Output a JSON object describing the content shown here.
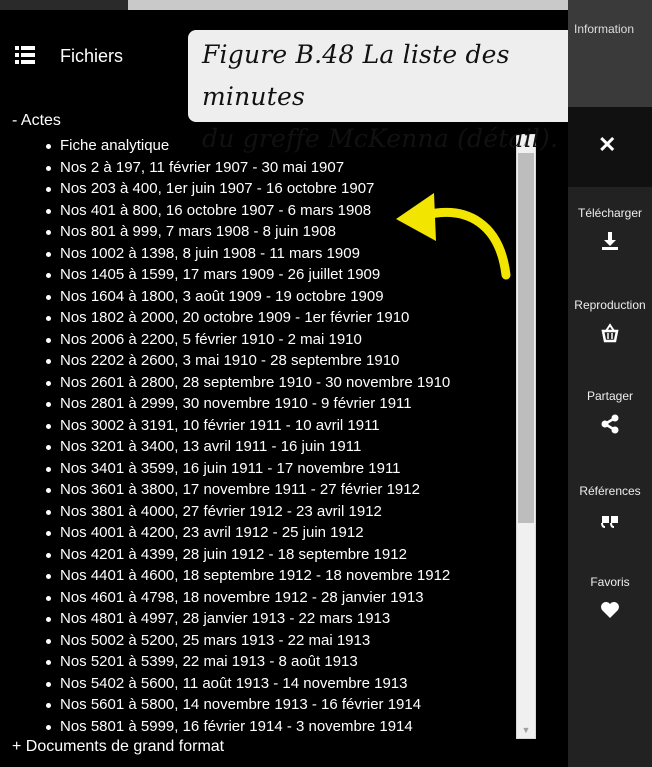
{
  "header": {
    "title": "Fichiers",
    "menu_icon": "list-icon"
  },
  "caption": {
    "line1": "Figure B.48 La liste des minutes",
    "line2": "du greffe McKenna (détail)."
  },
  "tree": {
    "root_label": "- Actes",
    "items": [
      "Fiche analytique",
      "Nos 2 à 197, 11 février 1907 - 30 mai 1907",
      "Nos 203 à 400, 1er juin 1907 - 16 octobre 1907",
      "Nos 401 à 800, 16 octobre 1907 - 6 mars 1908",
      "Nos 801 à 999, 7 mars 1908 - 8 juin 1908",
      "Nos 1002 à 1398, 8 juin 1908 - 11 mars 1909",
      "Nos 1405 à 1599, 17 mars 1909 - 26 juillet 1909",
      "Nos 1604 à 1800, 3 août 1909 - 19 octobre 1909",
      "Nos 1802 à 2000, 20 octobre 1909 - 1er février 1910",
      "Nos 2006 à 2200, 5 février 1910 - 2 mai 1910",
      "Nos 2202 à 2600, 3 mai 1910 - 28 septembre 1910",
      "Nos 2601 à 2800, 28 septembre 1910 - 30 novembre 1910",
      "Nos 2801 à 2999, 30 novembre 1910 - 9 février 1911",
      "Nos 3002 à 3191, 10 février 1911 - 10 avril 1911",
      "Nos 3201 à 3400, 13 avril 1911 - 16 juin 1911",
      "Nos 3401 à 3599, 16 juin 1911 - 17 novembre 1911",
      "Nos 3601 à 3800, 17 novembre 1911 - 27 février 1912",
      "Nos 3801 à 4000, 27 février 1912 - 23 avril 1912",
      "Nos 4001 à 4200, 23 avril 1912 - 25 juin 1912",
      "Nos 4201 à 4399, 28 juin 1912 - 18 septembre 1912",
      "Nos 4401 à 4600, 18 septembre 1912 - 18 novembre 1912",
      "Nos 4601 à 4798, 18 novembre 1912 - 28 janvier 1913",
      "Nos 4801 à 4997, 28 janvier 1913 - 22 mars 1913",
      "Nos 5002 à 5200, 25 mars 1913 - 22 mai 1913",
      "Nos 5201 à 5399, 22 mai 1913 - 8 août 1913",
      "Nos 5402 à 5600, 11 août 1913 - 14 novembre 1913",
      "Nos 5601 à 5800, 14 novembre 1913 - 16 février 1914",
      "Nos 5801 à 5999, 16 février 1914 - 3 novembre 1914"
    ],
    "footer_label": "+ Documents de grand format"
  },
  "sidebar": {
    "top_label": "Information",
    "close_icon": "close-icon",
    "actions": [
      {
        "label": "Télécharger",
        "icon": "download-icon"
      },
      {
        "label": "Reproduction",
        "icon": "basket-icon"
      },
      {
        "label": "Partager",
        "icon": "share-icon"
      },
      {
        "label": "Références",
        "icon": "quote-icon"
      },
      {
        "label": "Favoris",
        "icon": "heart-icon"
      }
    ]
  },
  "colors": {
    "arrow": "#f2e600",
    "caption_bg": "#eeeeee",
    "sidebar_bg": "#222222"
  }
}
